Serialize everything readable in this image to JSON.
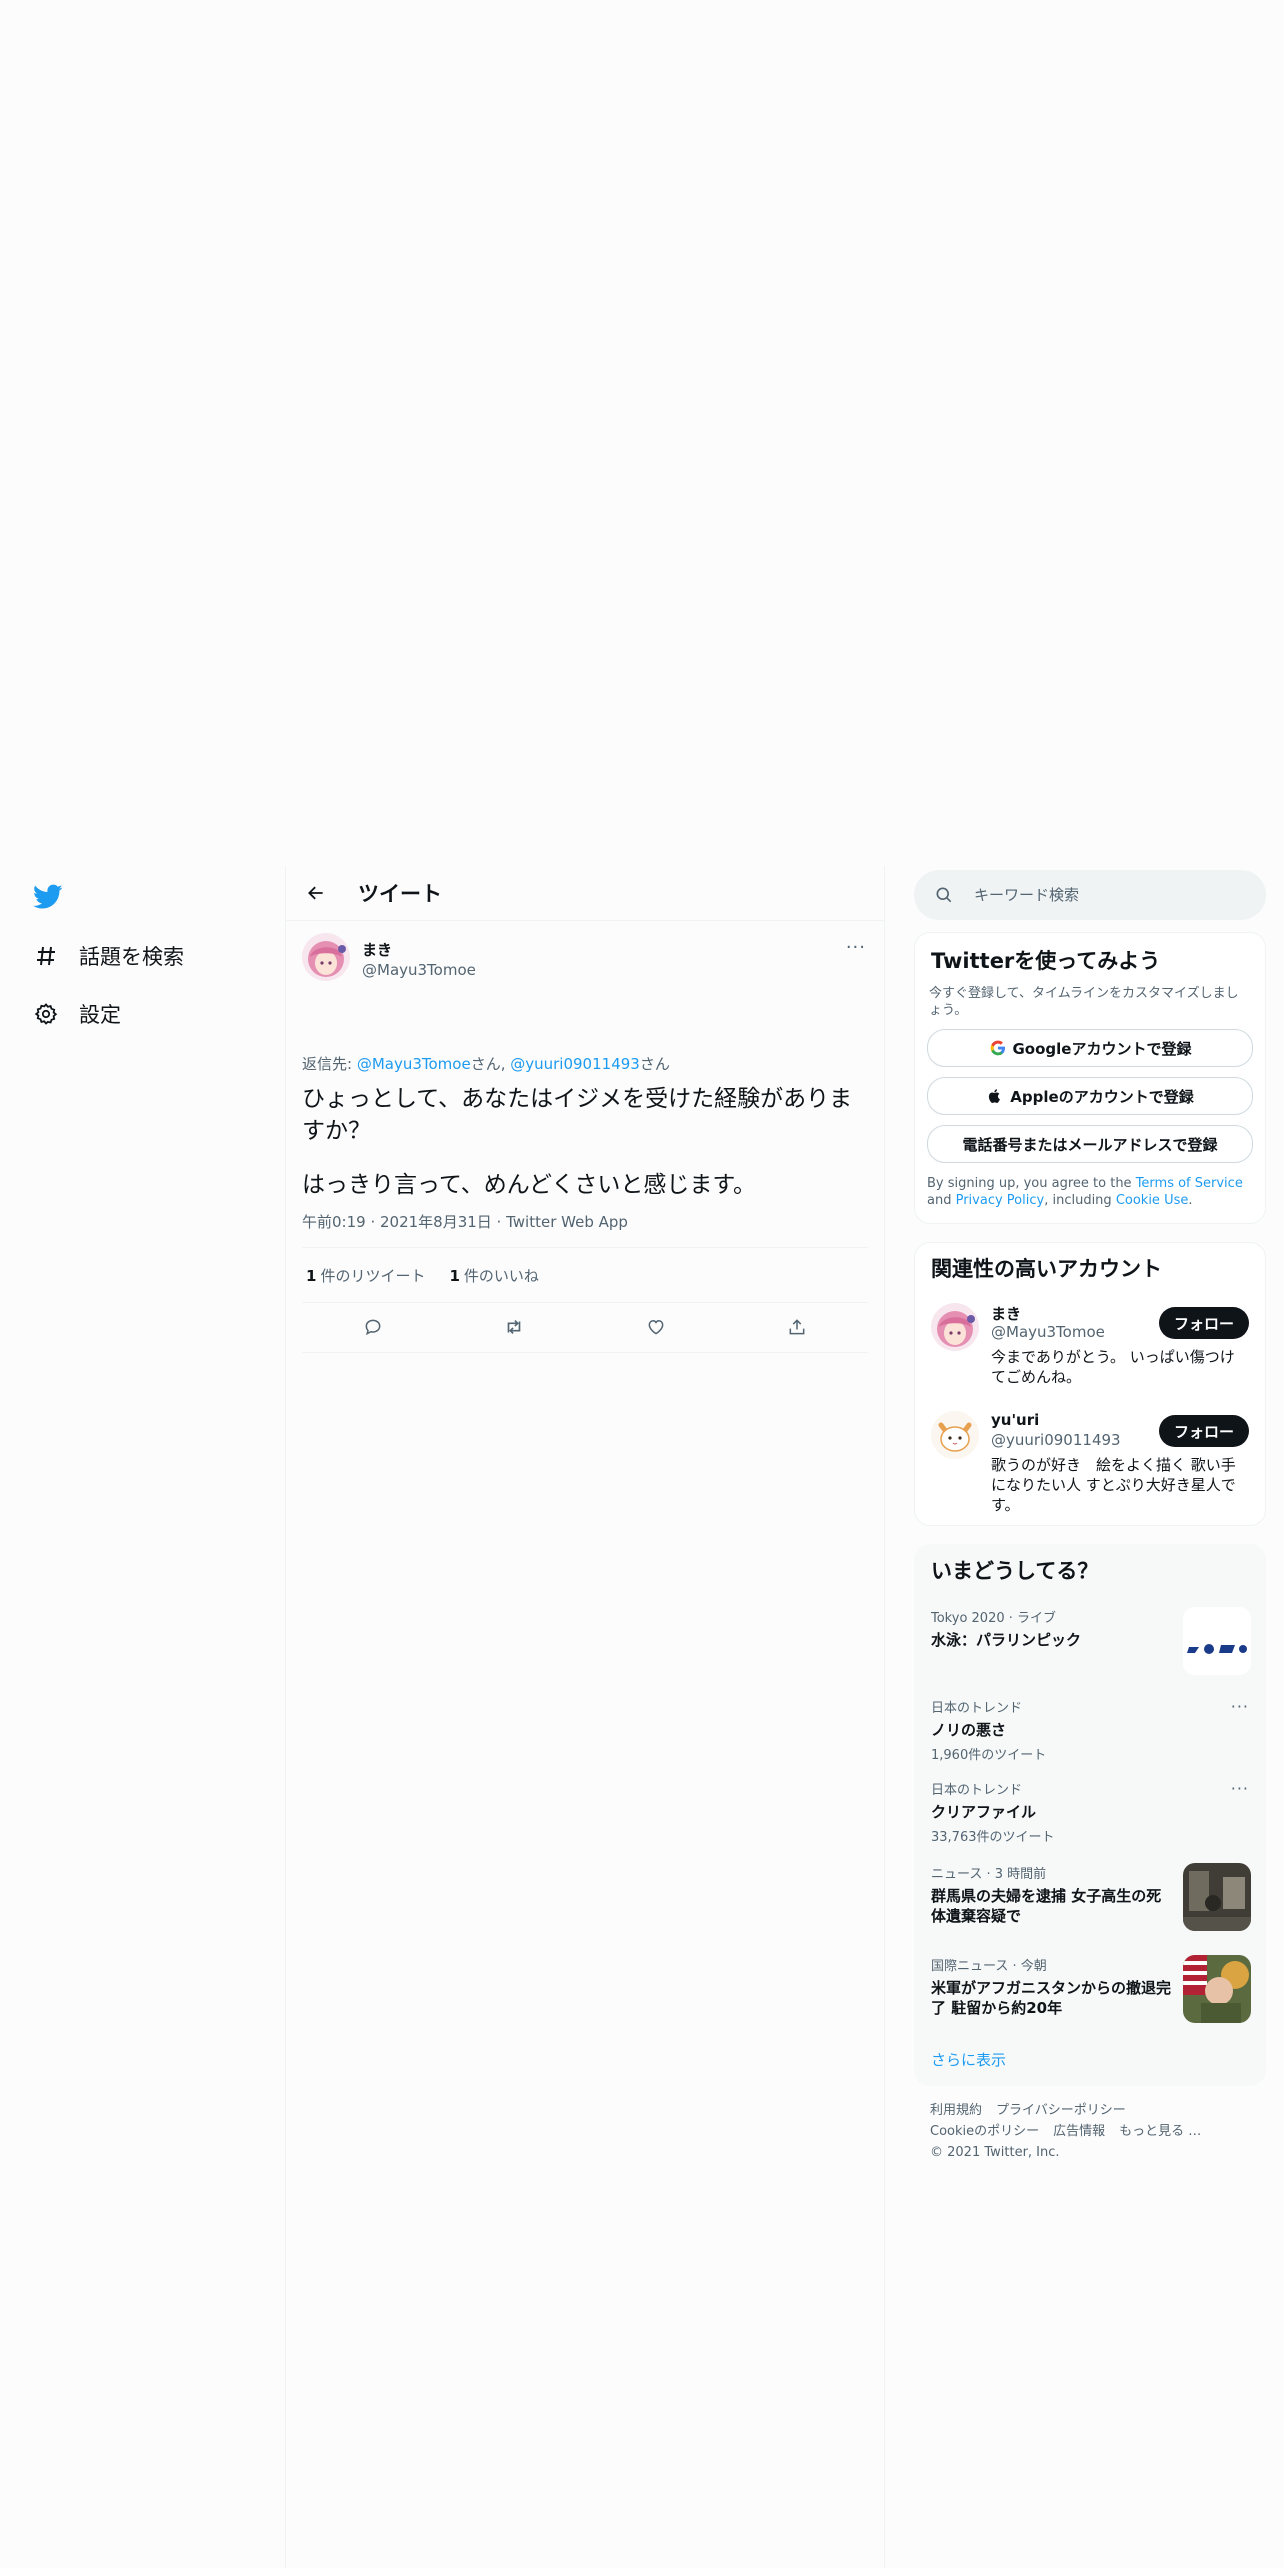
{
  "nav": {
    "items": [
      {
        "label": "話題を検索",
        "icon": "hashtag-icon"
      },
      {
        "label": "設定",
        "icon": "gear-icon"
      }
    ]
  },
  "header": {
    "title": "ツイート"
  },
  "tweet": {
    "author_name": "まき",
    "author_handle": "@Mayu3Tomoe",
    "replying_prefix": "返信先: ",
    "reply_to_1": "@Mayu3Tomoe",
    "reply_sep": "さん, ",
    "reply_to_2": "@yuuri09011493",
    "reply_suffix": "さん",
    "text_line1": "ひょっとして、あなたはイジメを受けた経験がありますか？",
    "text_line2": "はっきり言って、めんどくさいと感じます。",
    "timestamp": "午前0:19 · 2021年8月31日 · Twitter Web App",
    "retweet_count": "1",
    "retweet_label": "件のリツイート",
    "like_count": "1",
    "like_label": "件のいいね"
  },
  "search": {
    "placeholder": "キーワード検索"
  },
  "signup": {
    "title": "Twitterを使ってみよう",
    "subtitle": "今すぐ登録して、タイムラインをカスタマイズしましょう。",
    "google_btn": "Googleアカウントで登録",
    "apple_btn": "Appleのアカウントで登録",
    "phone_btn": "電話番号またはメールアドレスで登録",
    "legal_prefix": "By signing up, you agree to the ",
    "terms": "Terms of Service",
    "and": " and ",
    "privacy": "Privacy Policy",
    "including": ", including ",
    "cookie": "Cookie Use",
    "period": "."
  },
  "related": {
    "title": "関連性の高いアカウント",
    "follow_label": "フォロー",
    "accounts": [
      {
        "name": "まき",
        "handle": "@Mayu3Tomoe",
        "bio": "今までありがとう。 いっぱい傷つけてごめんね。"
      },
      {
        "name": "yu'uri",
        "handle": "@yuuri09011493",
        "bio": "歌うのが好き　絵をよく描く 歌い手になりたい人 すとぷり大好き星人です。"
      }
    ]
  },
  "trends": {
    "title": "いまどうしてる？",
    "items": [
      {
        "context": "Tokyo 2020 · ライブ",
        "name": "水泳：パラリンピック",
        "count": ""
      },
      {
        "context": "日本のトレンド",
        "name": "ノリの悪さ",
        "count": "1,960件のツイート"
      },
      {
        "context": "日本のトレンド",
        "name": "クリアファイル",
        "count": "33,763件のツイート"
      },
      {
        "context": "ニュース · 3 時間前",
        "name": "群馬県の夫婦を逮捕 女子高生の死体遺棄容疑で",
        "count": ""
      },
      {
        "context": "国際ニュース · 今朝",
        "name": "米軍がアフガニスタンからの撤退完了 駐留から約20年",
        "count": ""
      }
    ],
    "show_more": "さらに表示"
  },
  "footer": {
    "terms": "利用規約",
    "privacy": "プライバシーポリシー",
    "cookie": "Cookieのポリシー",
    "ads": "広告情報",
    "more": "もっと見る …",
    "copyright": "© 2021 Twitter, Inc."
  },
  "colors": {
    "accent": "#1d9bf0",
    "text": "#0f1419",
    "secondary": "#536471",
    "border": "#eff3f4"
  }
}
